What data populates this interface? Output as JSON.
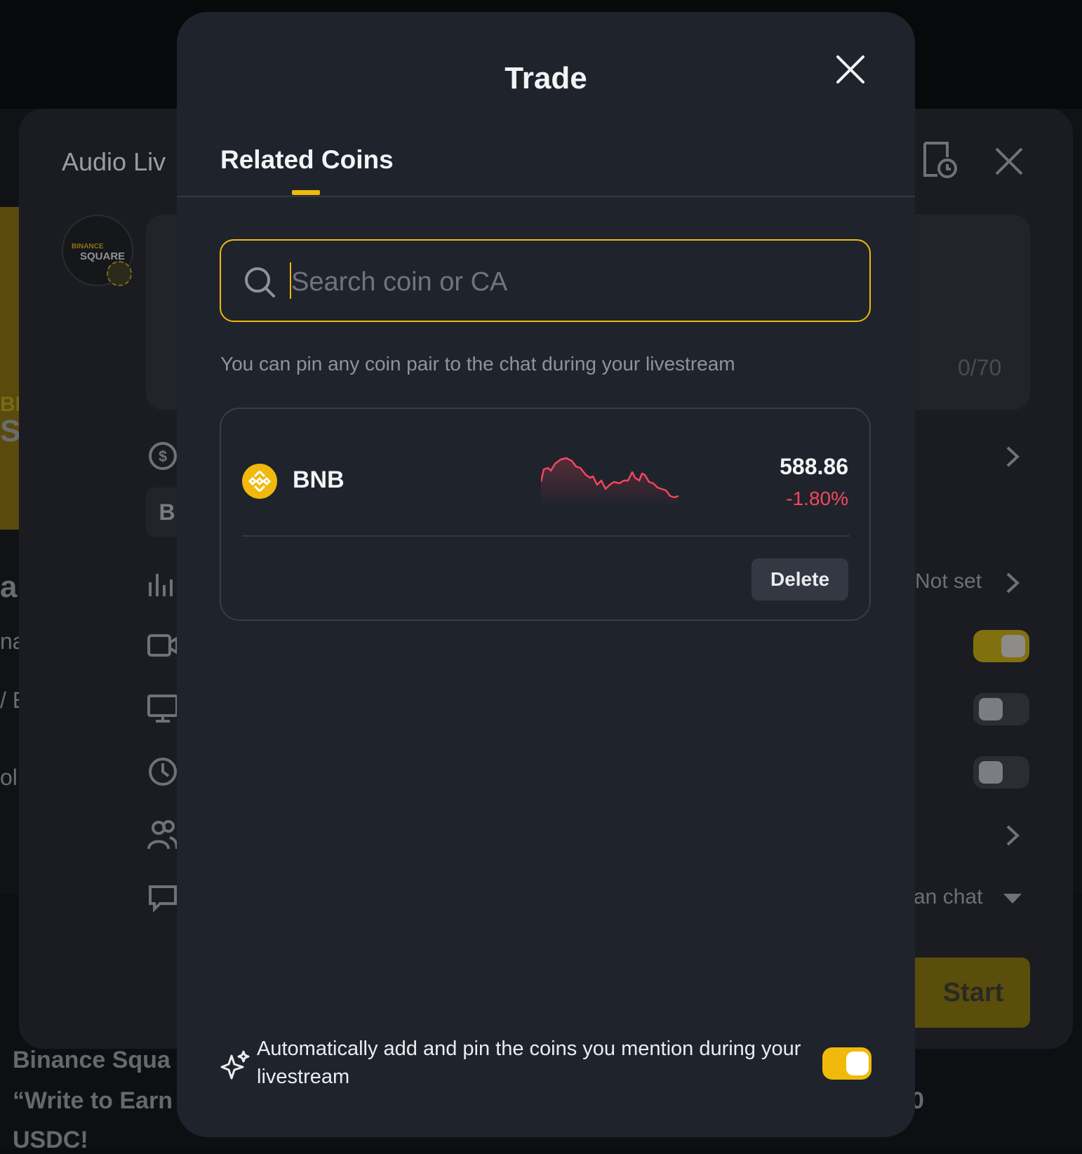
{
  "background": {
    "panel_title": "Audio Liv",
    "avatar_brand_top": "BINANCE",
    "avatar_brand_bottom": "SQUARE",
    "char_counter": "0/70",
    "chip_letter": "B",
    "not_set_label": "Not set",
    "chat_label": "an chat",
    "start_button": "Start",
    "left_fragments": [
      "BI",
      "S",
      "a",
      "na",
      "/ E",
      "ol"
    ],
    "bottom_line_1": "Binance Squa",
    "bottom_line_2": "“Write to Earn",
    "bottom_line_3": "USDC!",
    "bottom_right": "0"
  },
  "modal": {
    "title": "Trade",
    "tab": "Related Coins",
    "search": {
      "placeholder": "Search coin or CA",
      "value": ""
    },
    "hint": "You can pin any coin pair to the chat during your livestream",
    "coins": [
      {
        "symbol": "BNB",
        "price": "588.86",
        "change": "-1.80%",
        "change_color": "#f6465d",
        "delete_label": "Delete"
      }
    ],
    "auto_pin": {
      "text": "Automatically add and pin the coins you mention during your livestream",
      "enabled": true
    }
  },
  "colors": {
    "accent": "#f0b90b",
    "negative": "#f6465d",
    "modal_bg": "#1f232c"
  },
  "icons": [
    "close-icon",
    "search-icon",
    "bnb-logo-icon",
    "sparkle-icon",
    "dollar-icon",
    "audio-bars-icon",
    "video-icon",
    "monitor-icon",
    "clock-icon",
    "users-icon",
    "chat-icon",
    "chevron-right-icon",
    "schedule-icon"
  ]
}
